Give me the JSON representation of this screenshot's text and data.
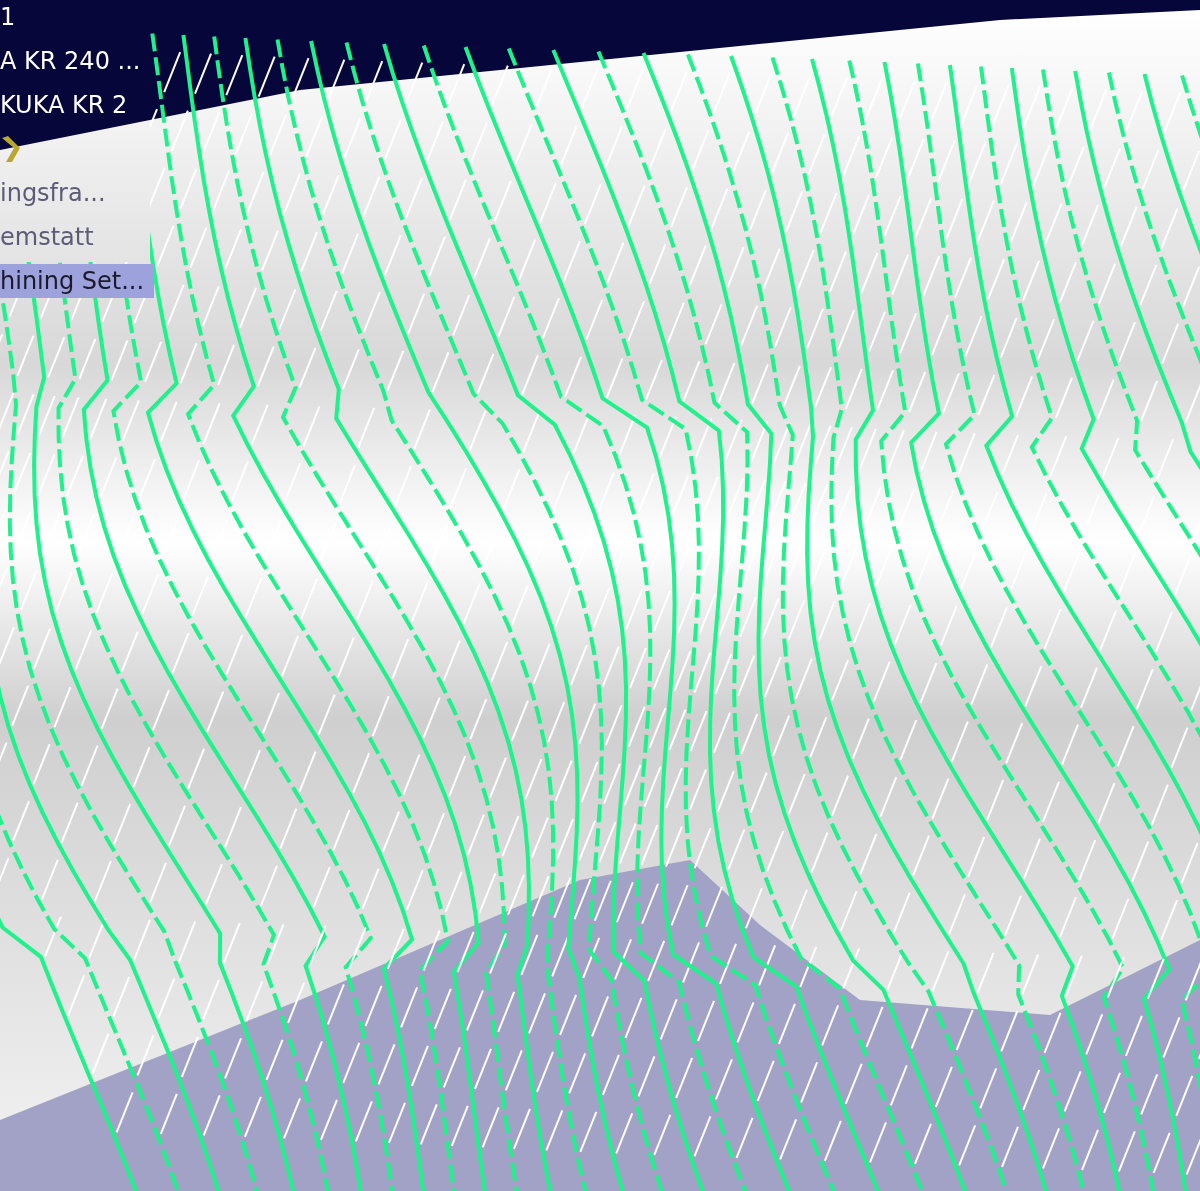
{
  "tree": {
    "items": [
      {
        "kind": "text",
        "label": "1",
        "selected": false
      },
      {
        "kind": "text",
        "label": "A KR 240 ...",
        "selected": false
      },
      {
        "kind": "text",
        "label": "KUKA KR 2",
        "selected": false
      },
      {
        "kind": "icon",
        "selected": false
      },
      {
        "kind": "text",
        "label": "ingsfra...",
        "selected": false
      },
      {
        "kind": "text",
        "label": "emstatt",
        "selected": false
      },
      {
        "kind": "text",
        "label": "hining Set...",
        "selected": true
      }
    ]
  }
}
